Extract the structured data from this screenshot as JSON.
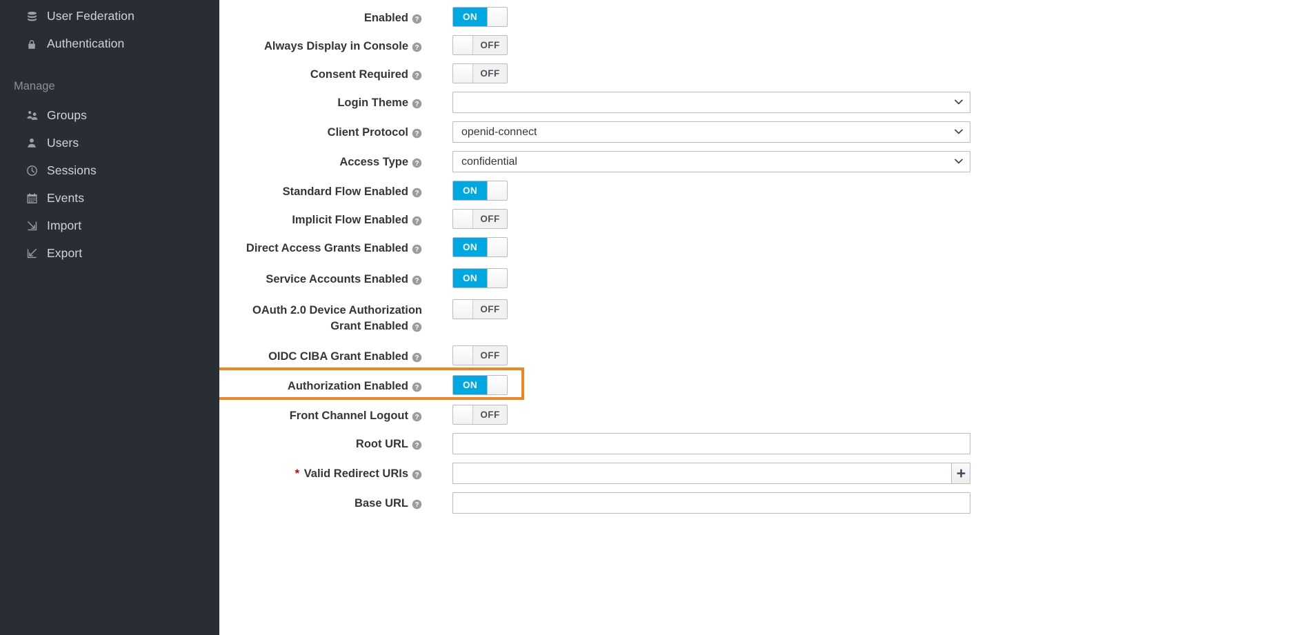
{
  "sidebar": {
    "items": [
      {
        "label": "User Federation",
        "icon": "database-icon"
      },
      {
        "label": "Authentication",
        "icon": "lock-icon"
      }
    ],
    "section_title": "Manage",
    "manage_items": [
      {
        "label": "Groups",
        "icon": "users-group-icon"
      },
      {
        "label": "Users",
        "icon": "user-icon"
      },
      {
        "label": "Sessions",
        "icon": "clock-icon"
      },
      {
        "label": "Events",
        "icon": "calendar-icon"
      },
      {
        "label": "Import",
        "icon": "import-arrow-icon"
      },
      {
        "label": "Export",
        "icon": "export-arrow-icon"
      }
    ]
  },
  "colors": {
    "sidebar_bg": "#292e34",
    "toggle_on": "#00a8e1",
    "highlight": "#f0851f",
    "required": "#cc0000"
  },
  "toggle_labels": {
    "on": "ON",
    "off": "OFF"
  },
  "form": {
    "rows": [
      {
        "label": "Enabled",
        "type": "toggle",
        "value": "ON"
      },
      {
        "label": "Always Display in Console",
        "type": "toggle",
        "value": "OFF"
      },
      {
        "label": "Consent Required",
        "type": "toggle",
        "value": "OFF"
      },
      {
        "label": "Login Theme",
        "type": "select",
        "value": ""
      },
      {
        "label": "Client Protocol",
        "type": "select",
        "value": "openid-connect"
      },
      {
        "label": "Access Type",
        "type": "select",
        "value": "confidential"
      },
      {
        "label": "Standard Flow Enabled",
        "type": "toggle",
        "value": "ON"
      },
      {
        "label": "Implicit Flow Enabled",
        "type": "toggle",
        "value": "OFF"
      },
      {
        "label": "Direct Access Grants Enabled",
        "type": "toggle",
        "value": "ON"
      },
      {
        "label": "Service Accounts Enabled",
        "type": "toggle",
        "value": "ON"
      },
      {
        "label": "OAuth 2.0 Device Authorization Grant Enabled",
        "type": "toggle",
        "value": "OFF"
      },
      {
        "label": "OIDC CIBA Grant Enabled",
        "type": "toggle",
        "value": "OFF"
      },
      {
        "label": "Authorization Enabled",
        "type": "toggle",
        "value": "ON",
        "highlighted": true
      },
      {
        "label": "Front Channel Logout",
        "type": "toggle",
        "value": "OFF"
      },
      {
        "label": "Root URL",
        "type": "text",
        "value": "",
        "placeholder": ""
      },
      {
        "label": "Valid Redirect URIs",
        "type": "text-add",
        "value": "",
        "placeholder": "",
        "required": true
      },
      {
        "label": "Base URL",
        "type": "text",
        "value": "",
        "placeholder": ""
      }
    ],
    "add_button_label": "+"
  }
}
